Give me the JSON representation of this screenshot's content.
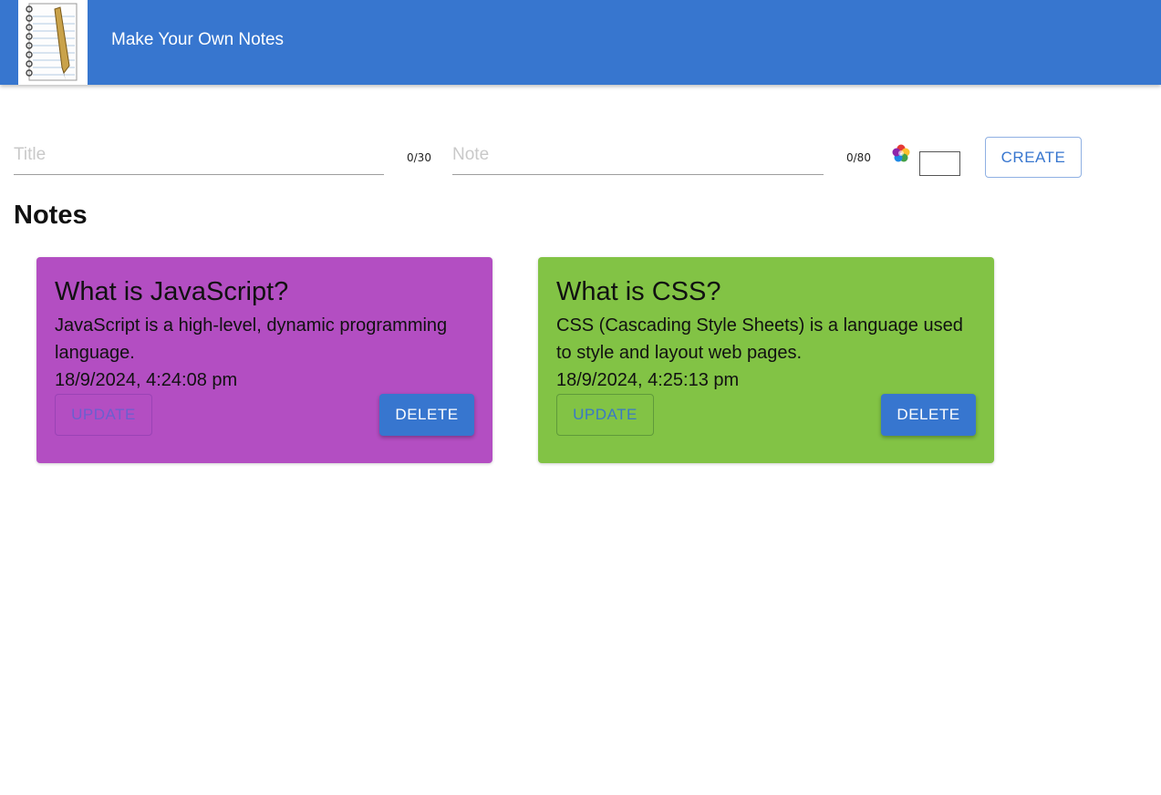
{
  "app": {
    "title": "Make Your Own Notes",
    "brand_color": "#3776cf",
    "logo_icon": "notepad-pen-icon"
  },
  "form": {
    "title_placeholder": "Title",
    "title_counter": "0/30",
    "note_placeholder": "Note",
    "note_counter": "0/80",
    "color_icon": "color-palette-icon",
    "create_label": "CREATE"
  },
  "notes_heading": "Notes",
  "notes": [
    {
      "title": "What is JavaScript?",
      "text": "JavaScript is a high-level, dynamic programming language.",
      "date": "18/9/2024, 4:24:08 pm",
      "color": "#b34ec2",
      "update_label": "UPDATE",
      "delete_label": "DELETE"
    },
    {
      "title": "What is CSS?",
      "text": "CSS (Cascading Style Sheets) is a language used to style and layout web pages.",
      "date": "18/9/2024, 4:25:13 pm",
      "color": "#82c345",
      "update_label": "UPDATE",
      "delete_label": "DELETE"
    }
  ]
}
